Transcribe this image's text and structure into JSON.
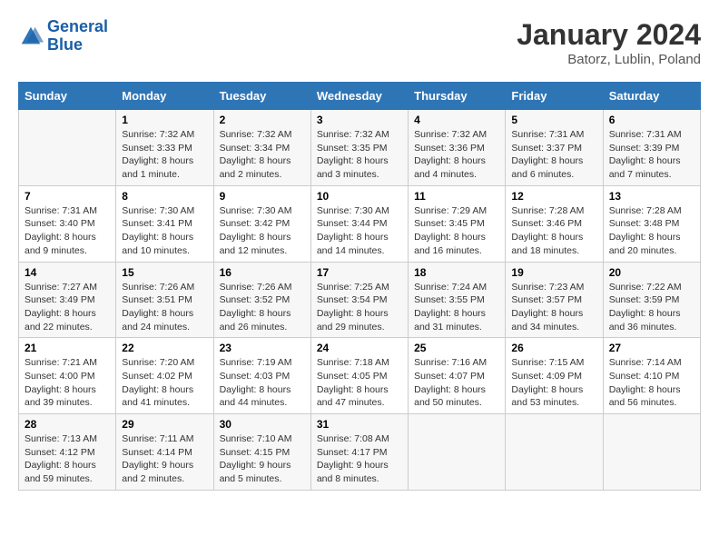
{
  "header": {
    "logo_line1": "General",
    "logo_line2": "Blue",
    "month_year": "January 2024",
    "location": "Batorz, Lublin, Poland"
  },
  "weekdays": [
    "Sunday",
    "Monday",
    "Tuesday",
    "Wednesday",
    "Thursday",
    "Friday",
    "Saturday"
  ],
  "weeks": [
    [
      {
        "day": "",
        "sunrise": "",
        "sunset": "",
        "daylight": ""
      },
      {
        "day": "1",
        "sunrise": "Sunrise: 7:32 AM",
        "sunset": "Sunset: 3:33 PM",
        "daylight": "Daylight: 8 hours and 1 minute."
      },
      {
        "day": "2",
        "sunrise": "Sunrise: 7:32 AM",
        "sunset": "Sunset: 3:34 PM",
        "daylight": "Daylight: 8 hours and 2 minutes."
      },
      {
        "day": "3",
        "sunrise": "Sunrise: 7:32 AM",
        "sunset": "Sunset: 3:35 PM",
        "daylight": "Daylight: 8 hours and 3 minutes."
      },
      {
        "day": "4",
        "sunrise": "Sunrise: 7:32 AM",
        "sunset": "Sunset: 3:36 PM",
        "daylight": "Daylight: 8 hours and 4 minutes."
      },
      {
        "day": "5",
        "sunrise": "Sunrise: 7:31 AM",
        "sunset": "Sunset: 3:37 PM",
        "daylight": "Daylight: 8 hours and 6 minutes."
      },
      {
        "day": "6",
        "sunrise": "Sunrise: 7:31 AM",
        "sunset": "Sunset: 3:39 PM",
        "daylight": "Daylight: 8 hours and 7 minutes."
      }
    ],
    [
      {
        "day": "7",
        "sunrise": "Sunrise: 7:31 AM",
        "sunset": "Sunset: 3:40 PM",
        "daylight": "Daylight: 8 hours and 9 minutes."
      },
      {
        "day": "8",
        "sunrise": "Sunrise: 7:30 AM",
        "sunset": "Sunset: 3:41 PM",
        "daylight": "Daylight: 8 hours and 10 minutes."
      },
      {
        "day": "9",
        "sunrise": "Sunrise: 7:30 AM",
        "sunset": "Sunset: 3:42 PM",
        "daylight": "Daylight: 8 hours and 12 minutes."
      },
      {
        "day": "10",
        "sunrise": "Sunrise: 7:30 AM",
        "sunset": "Sunset: 3:44 PM",
        "daylight": "Daylight: 8 hours and 14 minutes."
      },
      {
        "day": "11",
        "sunrise": "Sunrise: 7:29 AM",
        "sunset": "Sunset: 3:45 PM",
        "daylight": "Daylight: 8 hours and 16 minutes."
      },
      {
        "day": "12",
        "sunrise": "Sunrise: 7:28 AM",
        "sunset": "Sunset: 3:46 PM",
        "daylight": "Daylight: 8 hours and 18 minutes."
      },
      {
        "day": "13",
        "sunrise": "Sunrise: 7:28 AM",
        "sunset": "Sunset: 3:48 PM",
        "daylight": "Daylight: 8 hours and 20 minutes."
      }
    ],
    [
      {
        "day": "14",
        "sunrise": "Sunrise: 7:27 AM",
        "sunset": "Sunset: 3:49 PM",
        "daylight": "Daylight: 8 hours and 22 minutes."
      },
      {
        "day": "15",
        "sunrise": "Sunrise: 7:26 AM",
        "sunset": "Sunset: 3:51 PM",
        "daylight": "Daylight: 8 hours and 24 minutes."
      },
      {
        "day": "16",
        "sunrise": "Sunrise: 7:26 AM",
        "sunset": "Sunset: 3:52 PM",
        "daylight": "Daylight: 8 hours and 26 minutes."
      },
      {
        "day": "17",
        "sunrise": "Sunrise: 7:25 AM",
        "sunset": "Sunset: 3:54 PM",
        "daylight": "Daylight: 8 hours and 29 minutes."
      },
      {
        "day": "18",
        "sunrise": "Sunrise: 7:24 AM",
        "sunset": "Sunset: 3:55 PM",
        "daylight": "Daylight: 8 hours and 31 minutes."
      },
      {
        "day": "19",
        "sunrise": "Sunrise: 7:23 AM",
        "sunset": "Sunset: 3:57 PM",
        "daylight": "Daylight: 8 hours and 34 minutes."
      },
      {
        "day": "20",
        "sunrise": "Sunrise: 7:22 AM",
        "sunset": "Sunset: 3:59 PM",
        "daylight": "Daylight: 8 hours and 36 minutes."
      }
    ],
    [
      {
        "day": "21",
        "sunrise": "Sunrise: 7:21 AM",
        "sunset": "Sunset: 4:00 PM",
        "daylight": "Daylight: 8 hours and 39 minutes."
      },
      {
        "day": "22",
        "sunrise": "Sunrise: 7:20 AM",
        "sunset": "Sunset: 4:02 PM",
        "daylight": "Daylight: 8 hours and 41 minutes."
      },
      {
        "day": "23",
        "sunrise": "Sunrise: 7:19 AM",
        "sunset": "Sunset: 4:03 PM",
        "daylight": "Daylight: 8 hours and 44 minutes."
      },
      {
        "day": "24",
        "sunrise": "Sunrise: 7:18 AM",
        "sunset": "Sunset: 4:05 PM",
        "daylight": "Daylight: 8 hours and 47 minutes."
      },
      {
        "day": "25",
        "sunrise": "Sunrise: 7:16 AM",
        "sunset": "Sunset: 4:07 PM",
        "daylight": "Daylight: 8 hours and 50 minutes."
      },
      {
        "day": "26",
        "sunrise": "Sunrise: 7:15 AM",
        "sunset": "Sunset: 4:09 PM",
        "daylight": "Daylight: 8 hours and 53 minutes."
      },
      {
        "day": "27",
        "sunrise": "Sunrise: 7:14 AM",
        "sunset": "Sunset: 4:10 PM",
        "daylight": "Daylight: 8 hours and 56 minutes."
      }
    ],
    [
      {
        "day": "28",
        "sunrise": "Sunrise: 7:13 AM",
        "sunset": "Sunset: 4:12 PM",
        "daylight": "Daylight: 8 hours and 59 minutes."
      },
      {
        "day": "29",
        "sunrise": "Sunrise: 7:11 AM",
        "sunset": "Sunset: 4:14 PM",
        "daylight": "Daylight: 9 hours and 2 minutes."
      },
      {
        "day": "30",
        "sunrise": "Sunrise: 7:10 AM",
        "sunset": "Sunset: 4:15 PM",
        "daylight": "Daylight: 9 hours and 5 minutes."
      },
      {
        "day": "31",
        "sunrise": "Sunrise: 7:08 AM",
        "sunset": "Sunset: 4:17 PM",
        "daylight": "Daylight: 9 hours and 8 minutes."
      },
      {
        "day": "",
        "sunrise": "",
        "sunset": "",
        "daylight": ""
      },
      {
        "day": "",
        "sunrise": "",
        "sunset": "",
        "daylight": ""
      },
      {
        "day": "",
        "sunrise": "",
        "sunset": "",
        "daylight": ""
      }
    ]
  ]
}
